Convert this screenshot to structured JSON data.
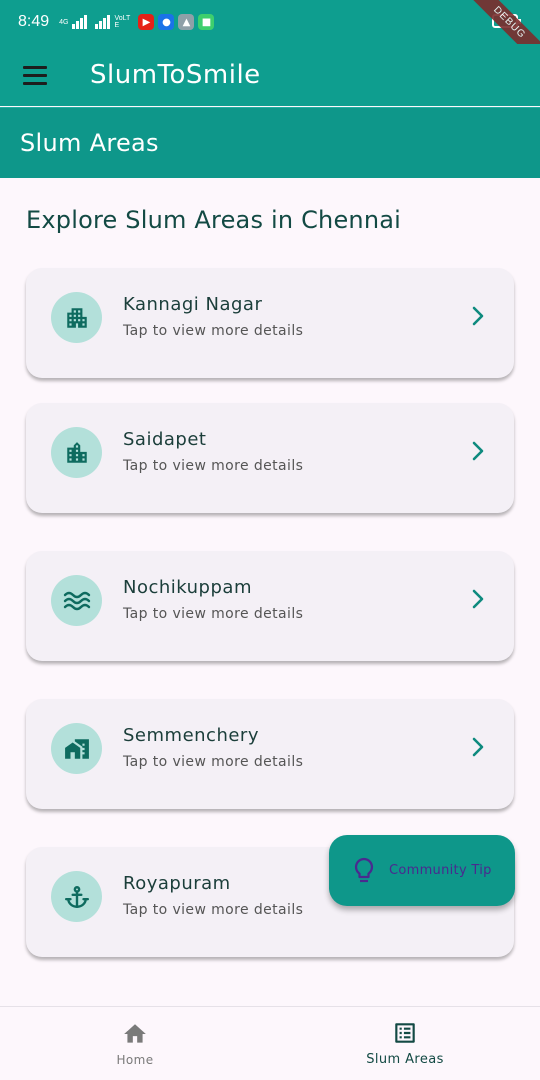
{
  "status_bar": {
    "time": "8:49",
    "network_label": "4G",
    "volte_label": "VoLTE",
    "debug_label": "DEBUG"
  },
  "app_bar": {
    "title": "SlumToSmile",
    "menu_icon": "hamburger-menu-icon"
  },
  "section_bar": {
    "title": "Slum Areas"
  },
  "main": {
    "heading": "Explore Slum Areas in Chennai",
    "areas": [
      {
        "name": "Kannagi Nagar",
        "subtitle": "Tap to view more details",
        "icon": "apartment-icon"
      },
      {
        "name": "Saidapet",
        "subtitle": "Tap to view more details",
        "icon": "city-building-icon"
      },
      {
        "name": "Nochikuppam",
        "subtitle": "Tap to view more details",
        "icon": "waves-icon"
      },
      {
        "name": "Semmenchery",
        "subtitle": "Tap to view more details",
        "icon": "home-work-icon"
      },
      {
        "name": "Royapuram",
        "subtitle": "Tap to view more details",
        "icon": "anchor-icon"
      }
    ]
  },
  "fab": {
    "label": "Community Tip",
    "icon": "lightbulb-icon"
  },
  "bottom_nav": {
    "items": [
      {
        "label": "Home",
        "icon": "home-icon",
        "active": false
      },
      {
        "label": "Slum Areas",
        "icon": "list-alt-icon",
        "active": true
      }
    ]
  },
  "colors": {
    "primary": "#0e9e8f",
    "section": "#0e978a",
    "icon_circle": "#b3e0da",
    "icon_fg": "#0e6b5f",
    "chevron": "#0e8a7e",
    "background": "#fdf7fc",
    "card": "#f4f0f6"
  }
}
